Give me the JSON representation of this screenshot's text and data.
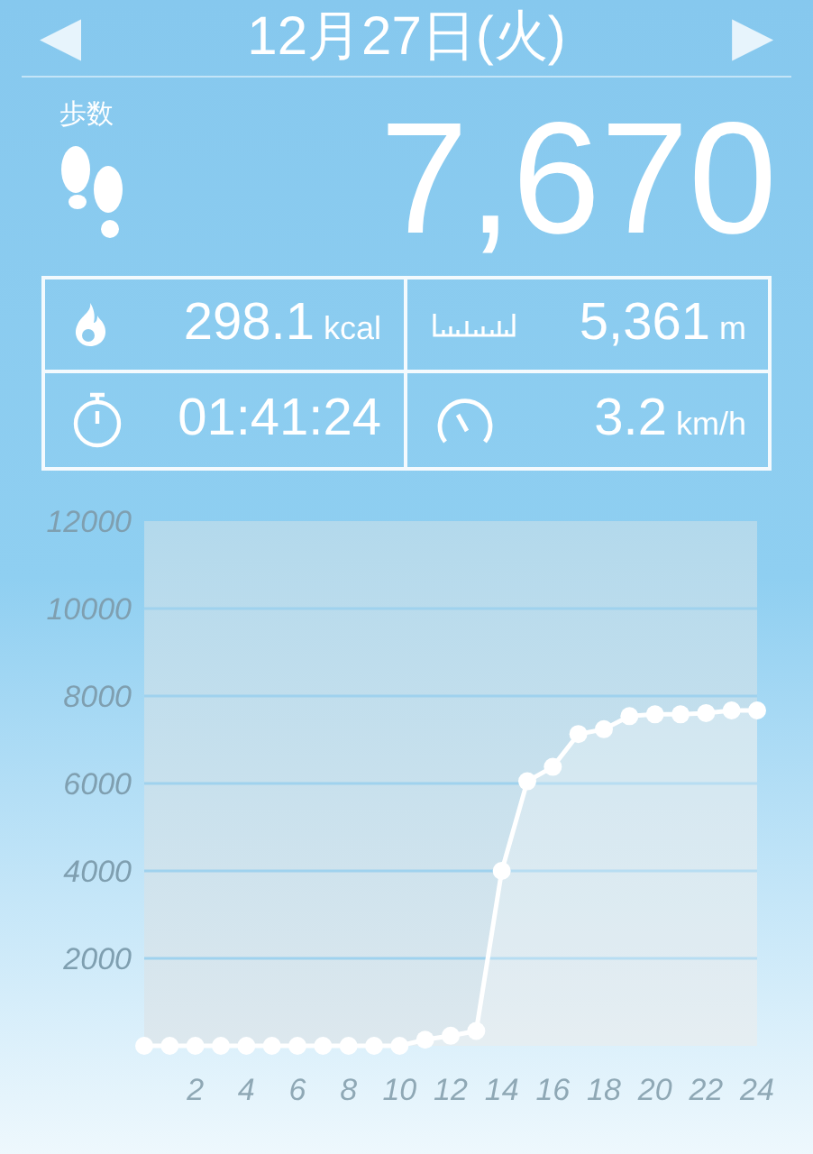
{
  "header": {
    "date": "12月27日(火)",
    "prev": "◀",
    "next": "▶"
  },
  "steps": {
    "label": "歩数",
    "value": "7,670"
  },
  "stats": [
    {
      "kind": "calories",
      "value": "298.1",
      "unit": "kcal"
    },
    {
      "kind": "distance",
      "value": "5,361",
      "unit": "m"
    },
    {
      "kind": "time",
      "value": "01:41:24"
    },
    {
      "kind": "speed",
      "value": "3.2",
      "unit": "km/h"
    }
  ],
  "chart_data": {
    "type": "area",
    "x": [
      0,
      1,
      2,
      3,
      4,
      5,
      6,
      7,
      8,
      9,
      10,
      11,
      12,
      13,
      14,
      15,
      16,
      17,
      18,
      19,
      20,
      21,
      22,
      23,
      24
    ],
    "grid": true,
    "series": [
      {
        "color": "#ffffff",
        "values": [
          0,
          0,
          0,
          0,
          0,
          0,
          0,
          0,
          0,
          0,
          0,
          140,
          230,
          340,
          4000,
          6050,
          6380,
          7130,
          7240,
          7540,
          7580,
          7580,
          7610,
          7670,
          7670
        ]
      }
    ],
    "xlim": [
      0,
      24
    ],
    "ylim": [
      0,
      12000
    ],
    "xticks": [
      2,
      4,
      6,
      8,
      10,
      12,
      14,
      16,
      18,
      20,
      22,
      24
    ],
    "yticks": [
      2000,
      4000,
      6000,
      8000,
      10000,
      12000
    ]
  }
}
